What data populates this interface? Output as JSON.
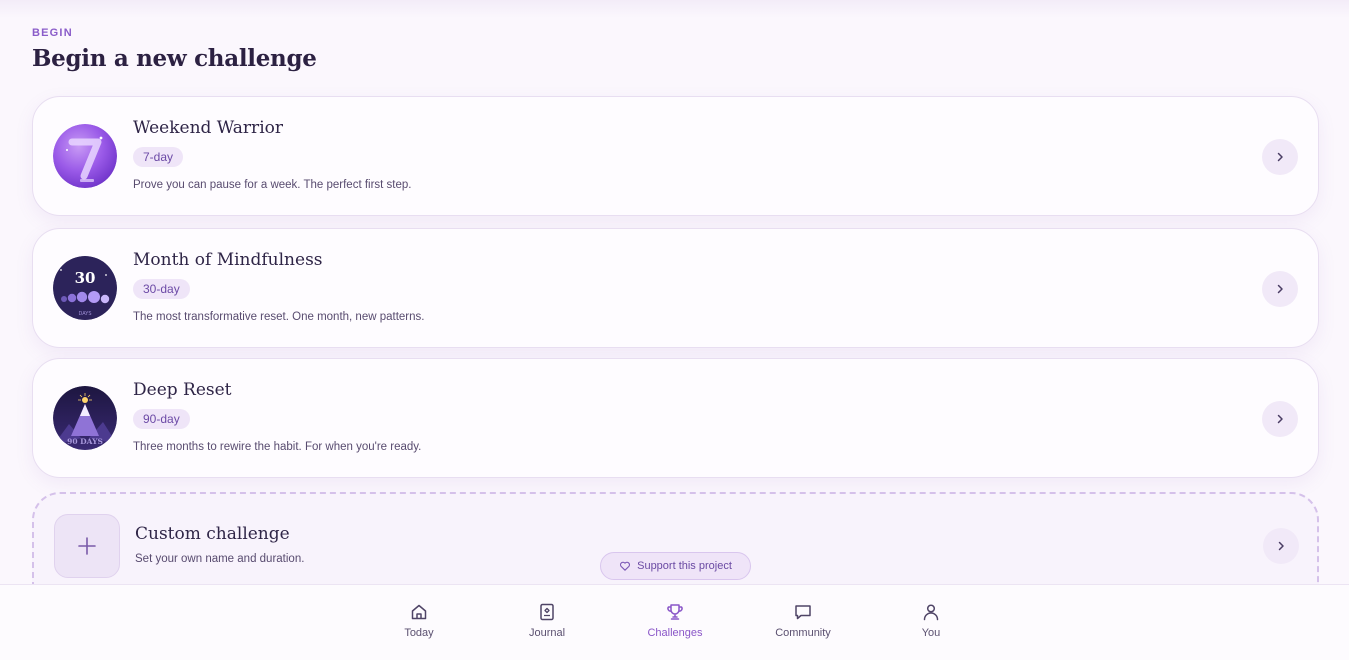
{
  "section": {
    "eyebrow": "BEGIN",
    "title": "Begin a new challenge"
  },
  "challenges": [
    {
      "title": "Weekend Warrior",
      "duration": "7-day",
      "description": "Prove you can pause for a week. The perfect first step.",
      "icon": "seven-days-badge-icon"
    },
    {
      "title": "Month of Mindfulness",
      "duration": "30-day",
      "description": "The most transformative reset. One month, new patterns.",
      "icon": "thirty-days-moon-phases-icon",
      "badge_number": "30",
      "badge_caption": "DAYS"
    },
    {
      "title": "Deep Reset",
      "duration": "90-day",
      "description": "Three months to rewire the habit. For when you're ready.",
      "icon": "ninety-days-mountain-icon",
      "badge_caption": "90 DAYS"
    }
  ],
  "custom": {
    "title": "Custom challenge",
    "description": "Set your own name and duration."
  },
  "support": {
    "label": "Support this project"
  },
  "nav": {
    "items": [
      {
        "label": "Today",
        "icon": "home-icon"
      },
      {
        "label": "Journal",
        "icon": "journal-icon"
      },
      {
        "label": "Challenges",
        "icon": "trophy-icon"
      },
      {
        "label": "Community",
        "icon": "chat-bubble-icon"
      },
      {
        "label": "You",
        "icon": "user-icon"
      }
    ],
    "active": "Challenges"
  },
  "colors": {
    "background": "#fbf7fd",
    "accent": "#8a56c8",
    "pill_background": "#efe5f8",
    "title_text": "#2f2547"
  }
}
